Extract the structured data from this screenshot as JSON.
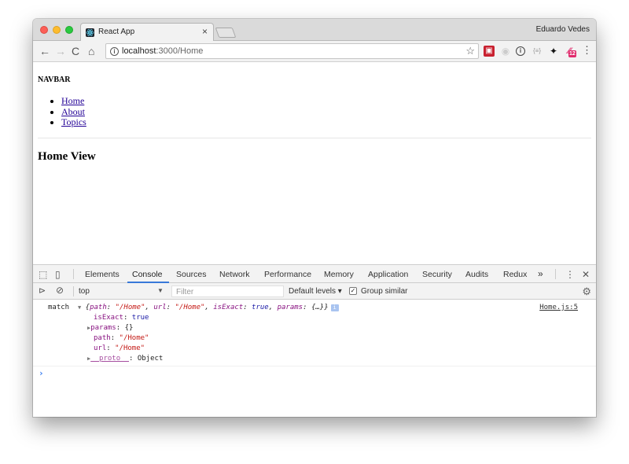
{
  "browser": {
    "tab_title": "React App",
    "tab_close": "×",
    "profile_name": "Eduardo Vedes",
    "url_host": "localhost",
    "url_path": ":3000/Home"
  },
  "page": {
    "navbar_title": "NAVBAR",
    "nav_links": [
      "Home",
      "About",
      "Topics"
    ],
    "heading": "Home View"
  },
  "devtools": {
    "tabs": [
      "Elements",
      "Console",
      "Sources",
      "Network",
      "Performance",
      "Memory",
      "Application",
      "Security",
      "Audits",
      "Redux"
    ],
    "active_tab": "Console",
    "more_tabs": "»",
    "context": "top",
    "filter_placeholder": "Filter",
    "levels": "Default levels ▾",
    "group_similar": "Group similar",
    "group_similar_checked": true
  },
  "console": {
    "log_label": "match",
    "source": "Home.js:5",
    "summary": {
      "path_key": "path",
      "path_val": "\"/Home\"",
      "url_key": "url",
      "url_val": "\"/Home\"",
      "isExact_key": "isExact",
      "isExact_val": "true",
      "params_key": "params",
      "params_val": "{…}"
    },
    "props": [
      {
        "key": "isExact",
        "val": "true"
      },
      {
        "key": "params",
        "val": "{}"
      },
      {
        "key": "path",
        "val": "\"/Home\""
      },
      {
        "key": "url",
        "val": "\"/Home\""
      },
      {
        "key": "__proto__",
        "val": "Object"
      }
    ],
    "prompt": "›"
  }
}
